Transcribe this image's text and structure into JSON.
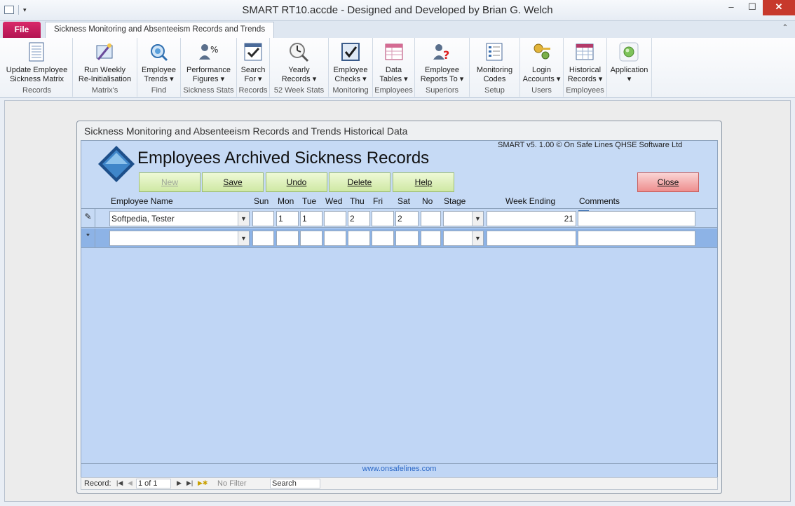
{
  "window": {
    "title": "SMART RT10.accde - Designed and Developed by Brian G. Welch",
    "minimize": "–",
    "maximize": "☐",
    "close": "✕"
  },
  "tabs": {
    "file": "File",
    "active": "Sickness Monitoring and Absenteeism Records and Trends"
  },
  "ribbon": {
    "groups": [
      {
        "lines": [
          "Update Employee",
          "Sickness Matrix"
        ],
        "group": "Records",
        "icon": "matrix-doc-icon"
      },
      {
        "lines": [
          "Run Weekly",
          "Re-Initialisation"
        ],
        "group": "Matrix's",
        "icon": "wand-icon"
      },
      {
        "lines": [
          "Employee",
          "Trends ▾"
        ],
        "group": "Find",
        "icon": "search-globe-icon"
      },
      {
        "lines": [
          "Performance",
          "Figures ▾"
        ],
        "group": "Sickness Stats",
        "icon": "percent-person-icon"
      },
      {
        "lines": [
          "Search",
          "For ▾"
        ],
        "group": "Records",
        "icon": "checklist-icon"
      },
      {
        "lines": [
          "Yearly",
          "Records ▾"
        ],
        "group": "52 Week Stats",
        "icon": "clock-magnifier-icon"
      },
      {
        "lines": [
          "Employee",
          "Checks ▾"
        ],
        "group": "Monitoring",
        "icon": "checkbox-icon"
      },
      {
        "lines": [
          "Data",
          "Tables ▾"
        ],
        "group": "Employees",
        "icon": "table-icon"
      },
      {
        "lines": [
          "Employee",
          "Reports To ▾"
        ],
        "group": "Superiors",
        "icon": "person-question-icon"
      },
      {
        "lines": [
          "Monitoring",
          "Codes"
        ],
        "group": "Setup",
        "icon": "codes-list-icon"
      },
      {
        "lines": [
          "Login",
          "Accounts ▾"
        ],
        "group": "Users",
        "icon": "keys-icon"
      },
      {
        "lines": [
          "Historical",
          "Records ▾"
        ],
        "group": "Employees",
        "icon": "historical-table-icon"
      },
      {
        "lines": [
          "Application",
          "▾"
        ],
        "group": "",
        "icon": "application-orb-icon"
      }
    ]
  },
  "form": {
    "window_title": "Sickness Monitoring and Absenteeism Records and Trends Historical Data",
    "heading": "Employees Archived Sickness Records",
    "copyright": "SMART v5. 1.00 © On Safe Lines QHSE Software Ltd",
    "buttons": {
      "new": "New",
      "save": "Save",
      "undo": "Undo",
      "delete": "Delete",
      "help": "Help",
      "close": "Close"
    },
    "columns": {
      "employee": "Employee Name",
      "sun": "Sun",
      "mon": "Mon",
      "tue": "Tue",
      "wed": "Wed",
      "thu": "Thu",
      "fri": "Fri",
      "sat": "Sat",
      "no": "No",
      "stage": "Stage",
      "week": "Week Ending",
      "comments": "Comments"
    },
    "record": {
      "selector": "✎",
      "employee": "Softpedia, Tester",
      "sun": "",
      "mon": "1",
      "tue": "1",
      "wed": "",
      "thu": "2",
      "fri": "",
      "sat": "2",
      "no": "",
      "stage": "",
      "week": "21",
      "comments": ""
    },
    "new_row_selector": "*",
    "website": "www.onsafelines.com"
  },
  "navigation": {
    "record_label": "Record:",
    "position": "1 of 1",
    "filter": "No Filter",
    "search": "Search"
  },
  "colors": {
    "file_tab": "#c0185a",
    "form_back": "#c0d6f5",
    "button_green": "#cfe8a4",
    "button_close": "#ee8e8e"
  }
}
